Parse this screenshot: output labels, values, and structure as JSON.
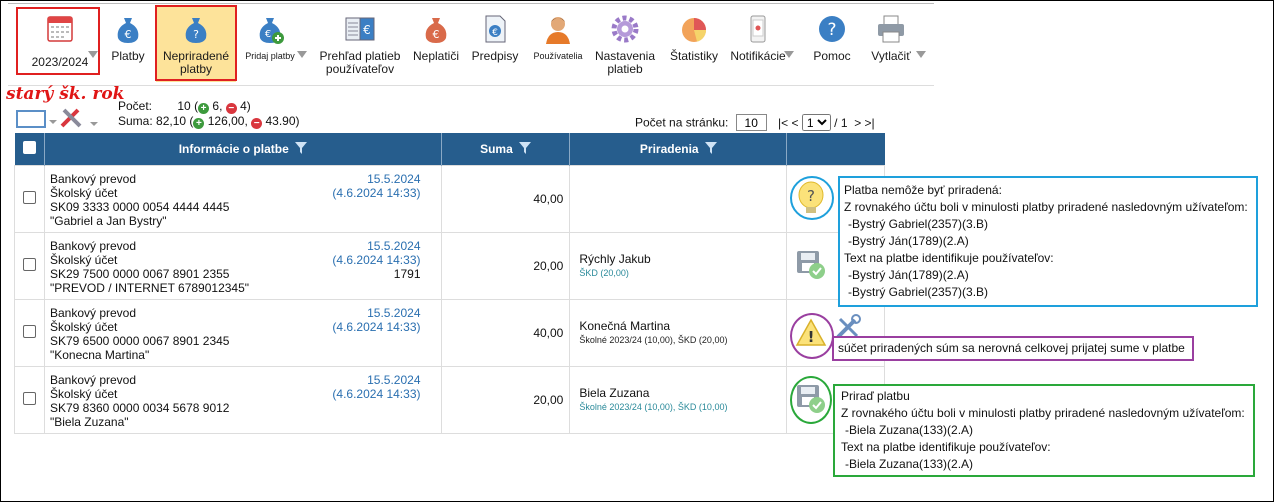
{
  "toolbar": {
    "year": "2023/2024",
    "items": [
      {
        "label": "Platby",
        "icon": "money-bag-euro-icon"
      },
      {
        "label": "Nepriradené platby",
        "icon": "money-bag-question-icon"
      },
      {
        "label": "Pridaj platby",
        "icon": "money-bag-add-icon"
      },
      {
        "label": "Prehľad platieb používateľov",
        "icon": "ledger-euro-icon"
      },
      {
        "label": "Neplatiči",
        "icon": "money-bag-debtor-icon"
      },
      {
        "label": "Predpisy",
        "icon": "document-euro-icon"
      },
      {
        "label": "Používatelia",
        "icon": "user-icon"
      },
      {
        "label": "Nastavenia platieb",
        "icon": "gear-icon"
      },
      {
        "label": "Štatistiky",
        "icon": "pie-chart-icon"
      },
      {
        "label": "Notifikácie",
        "icon": "phone-icon"
      },
      {
        "label": "Pomoc",
        "icon": "help-icon"
      },
      {
        "label": "Vytlačiť",
        "icon": "printer-icon"
      }
    ]
  },
  "annotation_old_year": "starý šk. rok",
  "stats": {
    "count_label": "Počet:",
    "count_value": "10",
    "count_pos": "6,",
    "count_neg": "4)",
    "sum_label": "Suma:",
    "sum_value": "82,10",
    "sum_pos": "126,00,",
    "sum_neg": "43.90)",
    "open_paren": "(",
    "plus": "+",
    "minus": "−"
  },
  "paging": {
    "per_page_label": "Počet na stránku:",
    "per_page_value": "10",
    "nav_first": "|<",
    "nav_prev": "<",
    "current_page": "1",
    "of": "/ 1",
    "nav_next": ">",
    "nav_last": ">|"
  },
  "table": {
    "headers": {
      "info": "Informácie o platbe",
      "sum": "Suma",
      "assign": "Priradenia"
    },
    "rows": [
      {
        "type": "Bankový prevod",
        "account_type": "Školský účet",
        "iban": "SK09 3333 0000 0054 4444 4445",
        "note": "\"Gabriel a Jan Bystry\"",
        "date": "15.5.2024",
        "datetime": "(4.6.2024 14:33)",
        "ref": "",
        "sum": "40,00",
        "assigned_name": "",
        "assigned_detail": ""
      },
      {
        "type": "Bankový prevod",
        "account_type": "Školský účet",
        "iban": "SK29 7500 0000 0067 8901 2355",
        "note": "\"PREVOD / INTERNET 6789012345\"",
        "date": "15.5.2024",
        "datetime": "(4.6.2024 14:33)",
        "ref": "1791",
        "sum": "20,00",
        "assigned_name": "Rýchly Jakub",
        "assigned_detail": "ŠKD (20,00)"
      },
      {
        "type": "Bankový prevod",
        "account_type": "Školský účet",
        "iban": "SK79 6500 0000 0067 8901 2345",
        "note": "\"Konecna Martina\"",
        "date": "15.5.2024",
        "datetime": "(4.6.2024 14:33)",
        "ref": "",
        "sum": "40,00",
        "assigned_name": "Konečná Martina",
        "assigned_detail": "Školné 2023/24 (10,00), ŠKD (20,00)"
      },
      {
        "type": "Bankový prevod",
        "account_type": "Školský účet",
        "iban": "SK79 8360 0000 0034 5678 9012",
        "note": "\"Biela Zuzana\"",
        "date": "15.5.2024",
        "datetime": "(4.6.2024 14:33)",
        "ref": "",
        "sum": "20,00",
        "assigned_name": "Biela Zuzana",
        "assigned_detail": "Školné 2023/24 (10,00), ŠKD (10,00)"
      }
    ]
  },
  "callouts": {
    "blue": [
      "Platba nemôže byť priradená:",
      "Z rovnakého účtu boli v minulosti platby priradené nasledovným užívateľom:",
      "-Bystrý Gabriel(2357)(3.B)",
      "-Bystrý Ján(1789)(2.A)",
      "Text na platbe identifikuje používateľov:",
      "-Bystrý Ján(1789)(2.A)",
      "-Bystrý Gabriel(2357)(3.B)"
    ],
    "purple": "súčet priradených súm sa nerovná celkovej prijatej sume v platbe",
    "green": [
      "Priraď platbu",
      "Z rovnakého účtu boli v minulosti platby priradené nasledovným užívateľom:",
      "-Biela Zuzana(133)(2.A)",
      "Text na platbe identifikuje používateľov:",
      "-Biela Zuzana(133)(2.A)"
    ]
  },
  "colors": {
    "header_blue": "#265d8d",
    "annotation_red": "#e01515",
    "callout_blue": "#1ea0dc",
    "callout_purple": "#9a3fa0",
    "callout_green": "#2aa83a"
  }
}
